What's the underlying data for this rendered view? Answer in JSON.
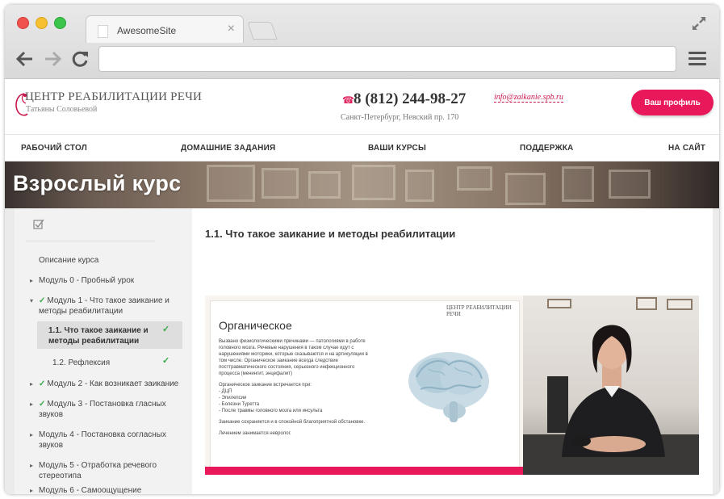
{
  "browser": {
    "tab_title": "AwesomeSite",
    "tab_close": "×",
    "address_value": ""
  },
  "header": {
    "logo_title": "ЦЕНТР РЕАБИЛИТАЦИИ РЕЧИ",
    "logo_subtitle": "Татьяны Соловьевой",
    "phone": "8 (812) 244-98-27",
    "address": "Санкт-Петербург, Невский пр. 170",
    "email": "info@zaikanie.spb.ru",
    "profile_button": "Ваш профиль",
    "accent_color": "#e8185a"
  },
  "nav": {
    "items": [
      "РАБОЧИЙ СТОЛ",
      "ДОМАШНИЕ ЗАДАНИЯ",
      "ВАШИ КУРСЫ",
      "ПОДДЕРЖКА",
      "НА САЙТ"
    ]
  },
  "banner": {
    "title": "Взрослый курс"
  },
  "sidebar": {
    "description": "Описание курса",
    "module0": "Модуль 0 - Пробный урок",
    "module1": "Модуль 1 - Что такое заикание и методы реабилитации",
    "lesson_1_1": "1.1. Что такое заикание и методы реабилитации",
    "lesson_1_2": "1.2. Рефлексия",
    "module2": "Модуль 2 - Как возникает заикание",
    "module3": "Модуль 3 - Постановка гласных звуков",
    "module4": "Модуль 4 - Постановка согласных звуков",
    "module5": "Модуль 5 - Отработка речевого стереотипа",
    "module6": "Модуль 6 - Самоощущение",
    "check": "✓",
    "arrow_right": "▸",
    "arrow_down": "▾"
  },
  "main": {
    "lesson_title": "1.1. Что такое заикание и методы реабилитации",
    "slide": {
      "logo": "ЦЕНТР РЕАБИЛИТАЦИИ РЕЧИ",
      "heading": "Органическое",
      "p1": "Вызвано физиологическими причинами — патологиями в работе головного мозга. Речевые нарушения в таком случае идут с нарушениями моторики, которые сказываются и на артикуляции в том числе. Органическое заикание всегда следствие посттравматического состояния, серьезного инфекционного процесса (менингит, энцефалит)",
      "p2_title": "Органическое заикание встречается при:",
      "p2_items": [
        "- ДЦП",
        "- Эпилепсии",
        "- Болезни Туретта",
        "- После травмы головного мозга или инсульта"
      ],
      "p3": "Заикание сохраняется и в спокойной благоприятной обстановке.",
      "p4": "Лечением занимается невролог."
    }
  }
}
